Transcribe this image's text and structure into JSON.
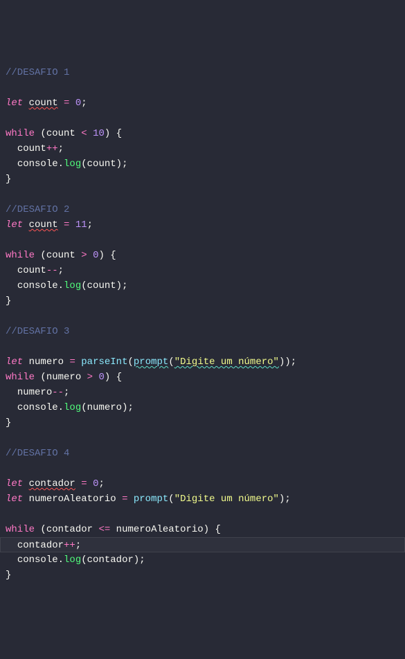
{
  "comments": {
    "d1": "//DESAFIO 1",
    "d2": "//DESAFIO 2",
    "d3": "//DESAFIO 3",
    "d4": "//DESAFIO 4"
  },
  "kw": {
    "let": "let",
    "while": "while"
  },
  "id": {
    "count": "count",
    "numero": "numero",
    "contador": "contador",
    "numeroAleatorio": "numeroAleatorio",
    "console": "console"
  },
  "fn": {
    "log": "log",
    "parseInt": "parseInt",
    "prompt": "prompt"
  },
  "num": {
    "zero": "0",
    "ten": "10",
    "eleven": "11"
  },
  "op": {
    "assign": "=",
    "lt": "<",
    "gt": ">",
    "le": "<=",
    "inc": "++",
    "dec": "--"
  },
  "punct": {
    "semi": ";",
    "openParen": "(",
    "closeParen": ")",
    "openBrace": "{",
    "closeBrace": "}",
    "dot": "."
  },
  "str": {
    "digite": "\"Digite um número\""
  }
}
